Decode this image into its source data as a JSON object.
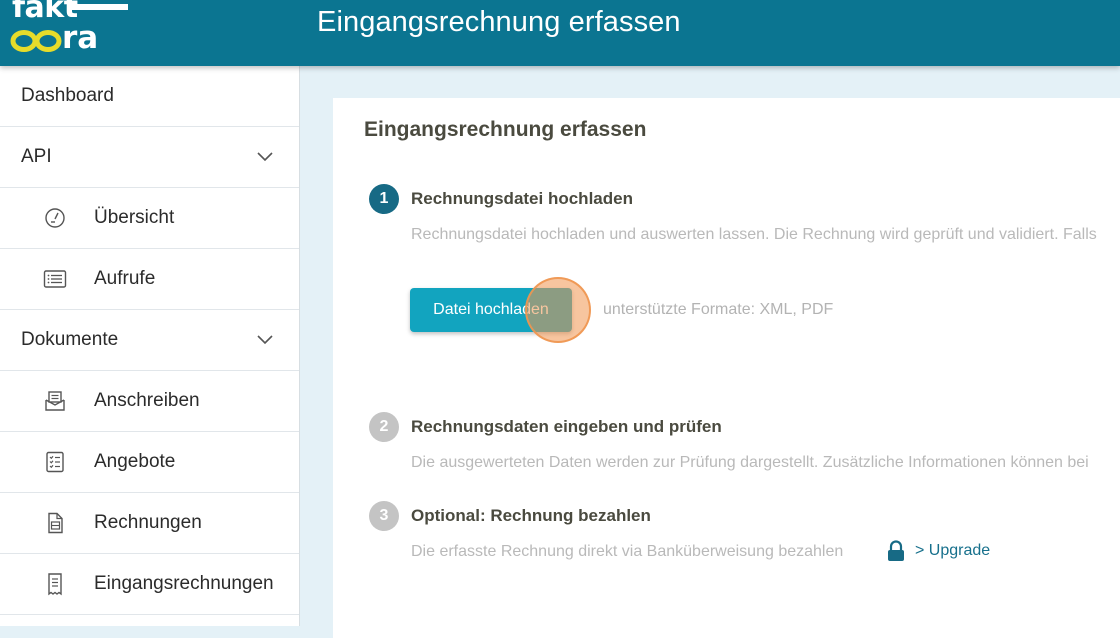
{
  "app": {
    "logo_top": "fakt",
    "logo_bottom": "ra",
    "header_title": "Eingangsrechnung erfassen"
  },
  "sidebar": {
    "items": [
      {
        "label": "Dashboard",
        "level": "top"
      },
      {
        "label": "API",
        "level": "top",
        "expandable": true
      },
      {
        "label": "Übersicht",
        "level": "sub",
        "icon": "gauge-icon"
      },
      {
        "label": "Aufrufe",
        "level": "sub",
        "icon": "list-icon"
      },
      {
        "label": "Dokumente",
        "level": "top",
        "expandable": true
      },
      {
        "label": "Anschreiben",
        "level": "sub",
        "icon": "letter-icon"
      },
      {
        "label": "Angebote",
        "level": "sub",
        "icon": "checklist-icon"
      },
      {
        "label": "Rechnungen",
        "level": "sub",
        "icon": "document-icon"
      },
      {
        "label": "Eingangsrechnungen",
        "level": "sub",
        "icon": "receipt-icon"
      }
    ]
  },
  "main": {
    "title": "Eingangsrechnung erfassen",
    "steps": [
      {
        "number": "1",
        "title": "Rechnungsdatei hochladen",
        "description": "Rechnungsdatei hochladen und auswerten lassen. Die Rechnung wird geprüft und validiert. Falls",
        "state": "active"
      },
      {
        "number": "2",
        "title": "Rechnungsdaten eingeben und prüfen",
        "description": "Die ausgewerteten Daten werden zur Prüfung dargestellt. Zusätzliche Informationen können bei",
        "state": "inactive"
      },
      {
        "number": "3",
        "title": "Optional: Rechnung bezahlen",
        "description": "Die erfasste Rechnung direkt via Banküberweisung bezahlen",
        "state": "inactive"
      }
    ],
    "upload_button": "Datei hochladen",
    "formats_hint": "unterstützte Formate: XML, PDF",
    "upgrade_link": "> Upgrade"
  },
  "colors": {
    "header": "#0b7591",
    "accent": "#12a4bf",
    "step_active": "#176a85",
    "step_inactive": "#c4c4c4",
    "logo_rings": "#e6dc2a",
    "click_marker": "#f0964f"
  }
}
